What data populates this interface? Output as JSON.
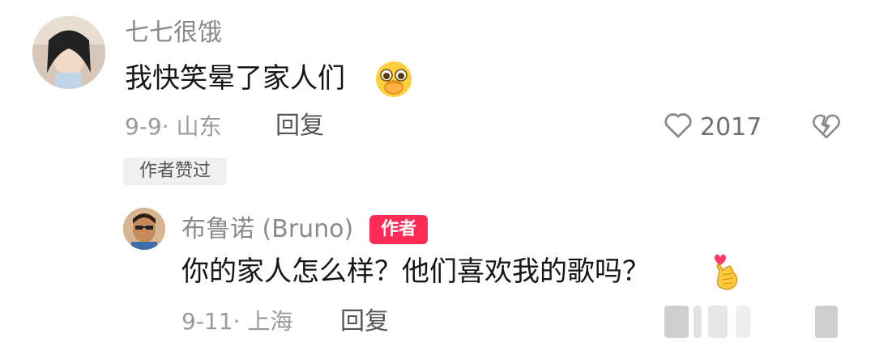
{
  "comment": {
    "username": "七七很饿",
    "text": "我快笑晕了家人们",
    "emoji": "shy-face-emoji",
    "meta": "9-9· 山东",
    "reply_label": "回复",
    "like_count": "2017",
    "author_liked_badge": "作者赞过"
  },
  "reply": {
    "username": "布鲁诺 (Bruno)",
    "author_tag": "作者",
    "text": "你的家人怎么样？他们喜欢我的歌吗？",
    "emoji": "finger-heart-emoji",
    "meta": "9-11· 上海",
    "reply_label": "回复"
  },
  "colors": {
    "author_tag_bg": "#fe2c55",
    "text_primary": "#161616",
    "text_secondary": "#8a8a8a"
  }
}
